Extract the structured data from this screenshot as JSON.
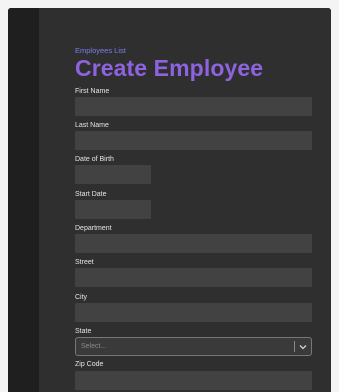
{
  "breadcrumb": "Employees List",
  "page_title": "Create Employee",
  "form": {
    "first_name": {
      "label": "First Name",
      "value": ""
    },
    "last_name": {
      "label": "Last Name",
      "value": ""
    },
    "date_of_birth": {
      "label": "Date of Birth",
      "value": ""
    },
    "start_date": {
      "label": "Start Date",
      "value": ""
    },
    "department": {
      "label": "Department",
      "value": ""
    },
    "street": {
      "label": "Street",
      "value": ""
    },
    "city": {
      "label": "City",
      "value": ""
    },
    "state": {
      "label": "State",
      "placeholder": "Select..."
    },
    "zip_code": {
      "label": "Zip Code",
      "value": ""
    }
  },
  "icons": {
    "state_dropdown": "chevron-down-icon"
  },
  "colors": {
    "title": "#8e63df",
    "breadcrumb": "#7c7cf0",
    "background": "#2f2f2f",
    "sidebar": "#1f1f1f",
    "input": "#424242"
  }
}
